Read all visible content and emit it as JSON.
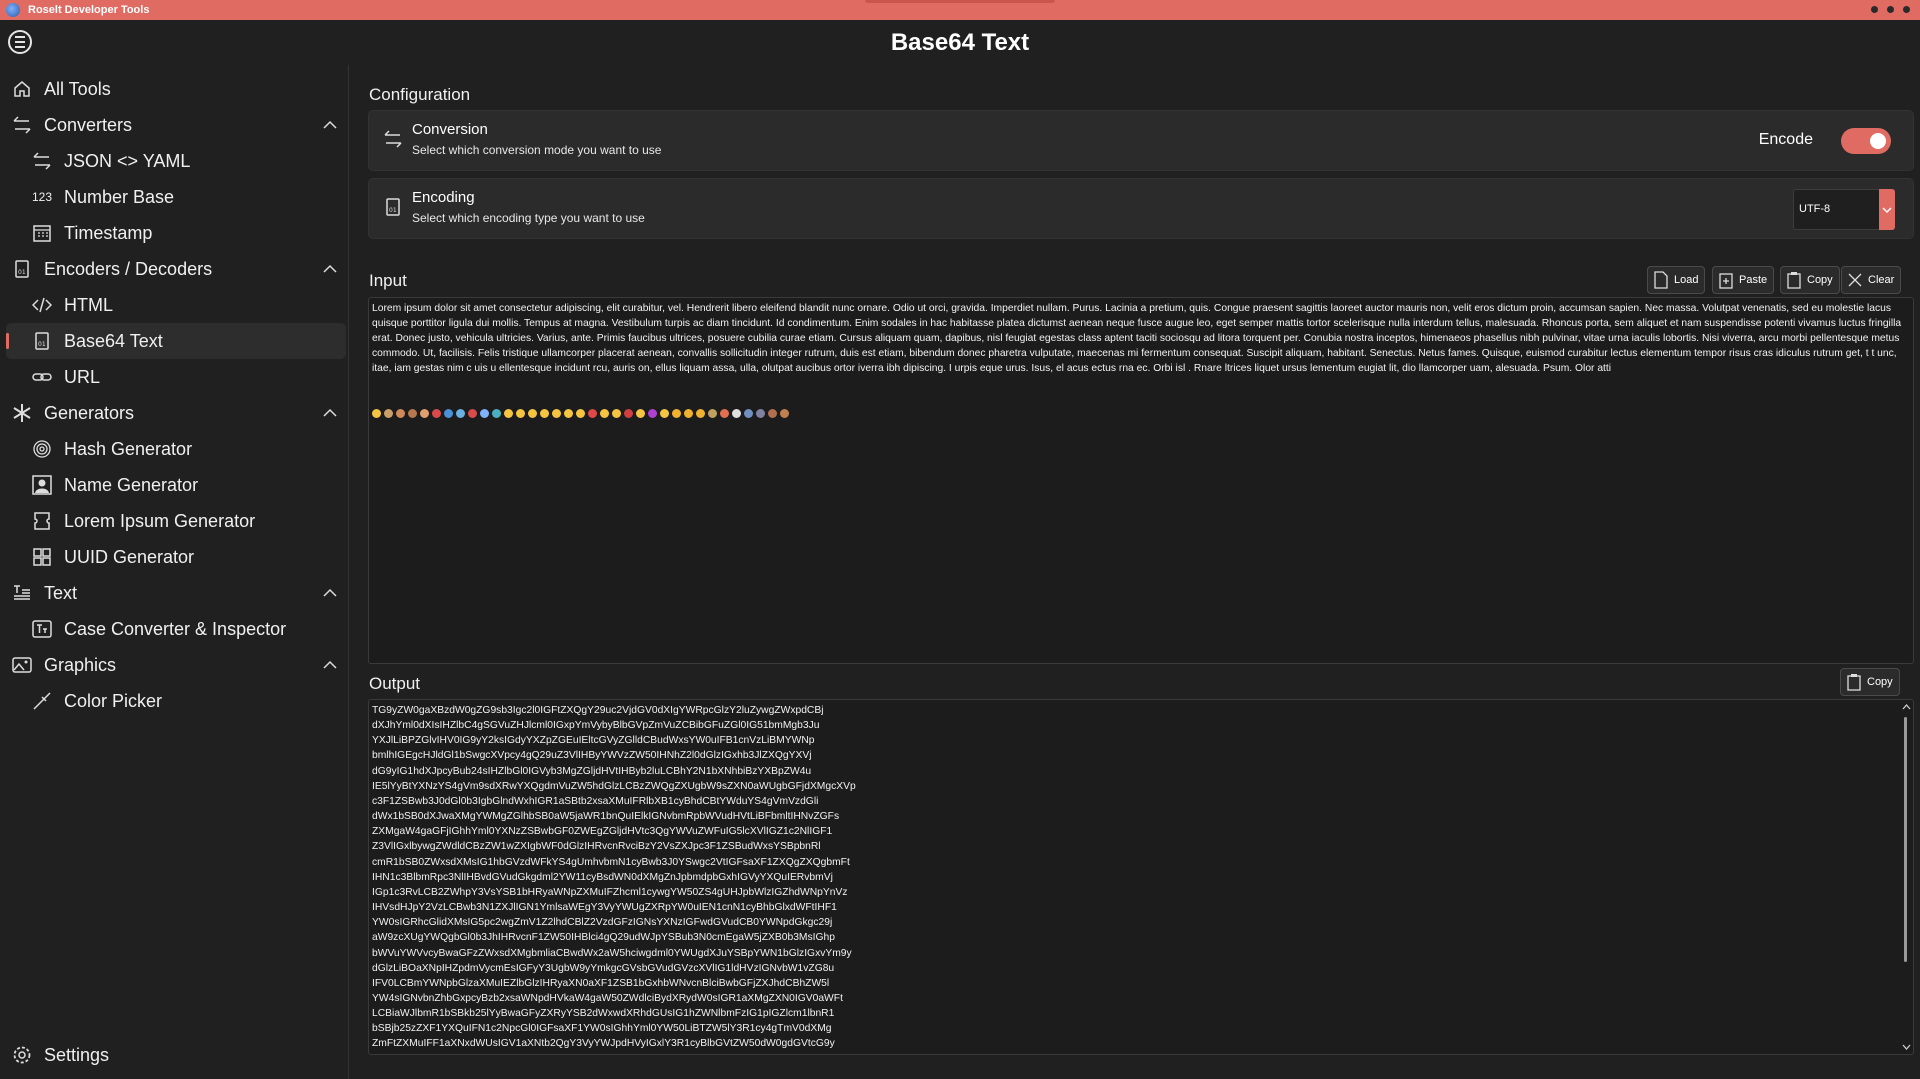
{
  "window": {
    "title": "Roselt Developer Tools"
  },
  "header": {
    "title": "Base64 Text"
  },
  "sidebar": {
    "items": [
      {
        "label": "All Tools",
        "icon": "home-icon",
        "level": "top"
      },
      {
        "label": "Converters",
        "icon": "arrows-swap-icon",
        "level": "top",
        "expanded": true
      },
      {
        "label": "JSON <> YAML",
        "icon": "arrows-swap-icon",
        "level": "sub"
      },
      {
        "label": "Number Base",
        "icon": "number-123-icon",
        "level": "sub"
      },
      {
        "label": "Timestamp",
        "icon": "calendar-icon",
        "level": "sub"
      },
      {
        "label": "Encoders / Decoders",
        "icon": "binary-file-icon",
        "level": "top",
        "expanded": true
      },
      {
        "label": "HTML",
        "icon": "code-icon",
        "level": "sub"
      },
      {
        "label": "Base64 Text",
        "icon": "binary-file-icon",
        "level": "sub",
        "active": true
      },
      {
        "label": "URL",
        "icon": "link-icon",
        "level": "sub"
      },
      {
        "label": "Generators",
        "icon": "asterisk-icon",
        "level": "top",
        "expanded": true
      },
      {
        "label": "Hash Generator",
        "icon": "fingerprint-icon",
        "level": "sub"
      },
      {
        "label": "Name Generator",
        "icon": "person-icon",
        "level": "sub"
      },
      {
        "label": "Lorem Ipsum Generator",
        "icon": "ticket-icon",
        "level": "sub"
      },
      {
        "label": "UUID Generator",
        "icon": "grid-icon",
        "level": "sub"
      },
      {
        "label": "Text",
        "icon": "text-icon",
        "level": "top",
        "expanded": true
      },
      {
        "label": "Case Converter & Inspector",
        "icon": "text-case-icon",
        "level": "sub"
      },
      {
        "label": "Graphics",
        "icon": "image-icon",
        "level": "top",
        "expanded": true
      },
      {
        "label": "Color Picker",
        "icon": "eyedropper-icon",
        "level": "sub"
      }
    ],
    "settings_label": "Settings"
  },
  "configuration": {
    "title": "Configuration",
    "conversion": {
      "title": "Conversion",
      "description": "Select which conversion mode you want to use",
      "toggle_label": "Encode",
      "toggle_on": true
    },
    "encoding": {
      "title": "Encoding",
      "description": "Select which encoding type you want to use",
      "selected": "UTF-8"
    }
  },
  "input": {
    "title": "Input",
    "buttons": {
      "load": "Load",
      "paste": "Paste",
      "copy": "Copy",
      "clear": "Clear"
    },
    "text": "Lorem ipsum dolor sit amet consectetur adipiscing, elit curabitur, vel. Hendrerit libero eleifend blandit nunc ornare. Odio ut orci, gravida. Imperdiet nullam. Purus. Lacinia a pretium, quis. Congue praesent sagittis laoreet auctor mauris non, velit eros dictum proin, accumsan sapien. Nec massa. Volutpat venenatis, sed eu molestie lacus quisque porttitor ligula dui mollis. Tempus at magna. Vestibulum turpis ac diam tincidunt. Id condimentum. Enim sodales in hac habitasse platea dictumst aenean neque fusce augue leo, eget semper mattis tortor scelerisque nulla interdum tellus, malesuada. Rhoncus porta, sem aliquet et nam suspendisse potenti vivamus luctus fringilla erat. Donec justo, vehicula ultricies. Varius, ante. Primis faucibus ultrices, posuere cubilia curae etiam. Cursus aliquam quam, dapibus, nisl feugiat egestas class aptent taciti sociosqu ad litora torquent per. Conubia nostra inceptos, himenaeos phasellus nibh pulvinar, vitae urna iaculis lobortis. Nisi viverra, arcu morbi pellentesque metus commodo. Ut, facilisis. Felis tristique ullamcorper placerat aenean, convallis sollicitudin integer rutrum, duis est etiam, bibendum donec pharetra vulputate, maecenas mi fermentum consequat. Suscipit aliquam, habitant. Senectus. Netus fames. Quisque, euismod curabitur lectus elementum tempor risus cras idiculus rutrum get, t t unc, itae, iam gestas nim c uis u ellentesque incidunt rcu, auris on, ellus liquam assa, ulla, olutpat aucibus ortor iverra ibh dipiscing. I urpis eque urus. Isus, el acus ectus rna ec. Orbi isl . Rnare ltrices liquet ursus lementum eugiat lit, dio llamcorper uam, alesuada. Psum. Olor atti",
    "emoji_colors": [
      "#f5c542",
      "#c9a06a",
      "#d08a5a",
      "#b5784f",
      "#e0a070",
      "#d94b4b",
      "#4a90d9",
      "#6ab0e0",
      "#d94b4b",
      "#7fb2ff",
      "#4ab0c0",
      "#f5c542",
      "#f5c542",
      "#f5c542",
      "#f5c542",
      "#f5c542",
      "#f5c542",
      "#f5c542",
      "#e04848",
      "#f5c542",
      "#f5c542",
      "#d04040",
      "#f5c542",
      "#b040d0",
      "#f5c542",
      "#f0b030",
      "#f0b030",
      "#f0b030",
      "#c0a060",
      "#e07050",
      "#e0e0e0",
      "#7090c0",
      "#8080a0",
      "#b07050",
      "#c08050"
    ]
  },
  "output": {
    "title": "Output",
    "copy_label": "Copy",
    "lines": [
      "TG9yZW0gaXBzdW0gZG9sb3Igc2l0IGFtZXQgY29uc2VjdGV0dXIgYWRpcGlzY2luZywgZWxpdCBj",
      "dXJhYml0dXIsIHZlbC4gSGVuZHJlcml0IGxpYmVybyBlbGVpZmVuZCBibGFuZGl0IG51bmMgb3Ju",
      "YXJlLiBPZGlvIHV0IG9yY2ksIGdyYXZpZGEuIEltcGVyZGlldCBudWxsYW0uIFB1cnVzLiBMYWNp",
      "bmlhIGEgcHJldGl1bSwgcXVpcy4gQ29uZ3VlIHByYWVzZW50IHNhZ2l0dGlzIGxhb3JlZXQgYXVj",
      "dG9yIG1hdXJpcyBub24sIHZlbGl0IGVyb3MgZGljdHVtIHByb2luLCBhY2N1bXNhbiBzYXBpZW4u",
      "IE5lYyBtYXNzYS4gVm9sdXRwYXQgdmVuZW5hdGlzLCBzZWQgZXUgbW9sZXN0aWUgbGFjdXMgcXVp",
      "c3F1ZSBwb3J0dGl0b3IgbGlndWxhIGR1aSBtb2xsaXMuIFRlbXB1cyBhdCBtYWduYS4gVmVzdGli",
      "dWx1bSB0dXJwaXMgYWMgZGlhbSB0aW5jaWR1bnQuIElkIGNvbmRpbWVudHVtLiBFbmltIHNvZGFs",
      "ZXMgaW4gaGFjIGhhYml0YXNzZSBwbGF0ZWEgZGljdHVtc3QgYWVuZWFuIG5lcXVlIGZ1c2NlIGF1",
      "Z3VlIGxlbywgZWdldCBzZW1wZXIgbWF0dGlzIHRvcnRvciBzY2VsZXJpc3F1ZSBudWxsYSBpbnRl",
      "cmR1bSB0ZWxsdXMsIG1hbGVzdWFkYS4gUmhvbmN1cyBwb3J0YSwgc2VtIGFsaXF1ZXQgZXQgbmFt",
      "IHN1c3BlbmRpc3NlIHBvdGVudGkgdml2YW11cyBsdWN0dXMgZnJpbmdpbGxhIGVyYXQuIERvbmVj",
      "IGp1c3RvLCB2ZWhpY3VsYSB1bHRyaWNpZXMuIFZhcml1cywgYW50ZS4gUHJpbWlzIGZhdWNpYnVz",
      "IHVsdHJpY2VzLCBwb3N1ZXJlIGN1YmlsaWEgY3VyYWUgZXRpYW0uIEN1cnN1cyBhbGlxdWFtIHF1",
      "YW0sIGRhcGlidXMsIG5pc2wgZmV1Z2lhdCBlZ2VzdGFzIGNsYXNzIGFwdGVudCB0YWNpdGkgc29j",
      "aW9zcXUgYWQgbGl0b3JhIHRvcnF1ZW50IHBlci4gQ29udWJpYSBub3N0cmEgaW5jZXB0b3MsIGhp",
      "bWVuYWVvcyBwaGFzZWxsdXMgbmliaCBwdWx2aW5hciwgdml0YWUgdXJuYSBpYWN1bGlzIGxvYm9y",
      "dGlzLiBOaXNpIHZpdmVycmEsIGFyY3UgbW9yYmkgcGVsbGVudGVzcXVlIG1ldHVzIGNvbW1vZG8u",
      "IFV0LCBmYWNpbGlzaXMuIEZlbGlzIHRyaXN0aXF1ZSB1bGxhbWNvcnBlciBwbGFjZXJhdCBhZW5l",
      "YW4sIGNvbnZhbGxpcyBzb2xsaWNpdHVkaW4gaW50ZWdlciBydXRydW0sIGR1aXMgZXN0IGV0aWFt",
      "LCBiaWJlbmR1bSBkb25lYyBwaGFyZXRyYSB2dWxwdXRhdGUsIG1hZWNlbmFzIG1pIGZlcm1lbnR1",
      "bSBjb25zZXF1YXQuIFN1c2NpcGl0IGFsaXF1YW0sIGhhYml0YW50LiBTZW5lY3R1cy4gTmV0dXMg",
      "ZmFtZXMuIFF1aXNxdWUsIGV1aXNtb2QgY3VyYWJpdHVyIGxlY3R1cyBlbGVtZW50dW0gdGVtcG9y"
    ]
  }
}
